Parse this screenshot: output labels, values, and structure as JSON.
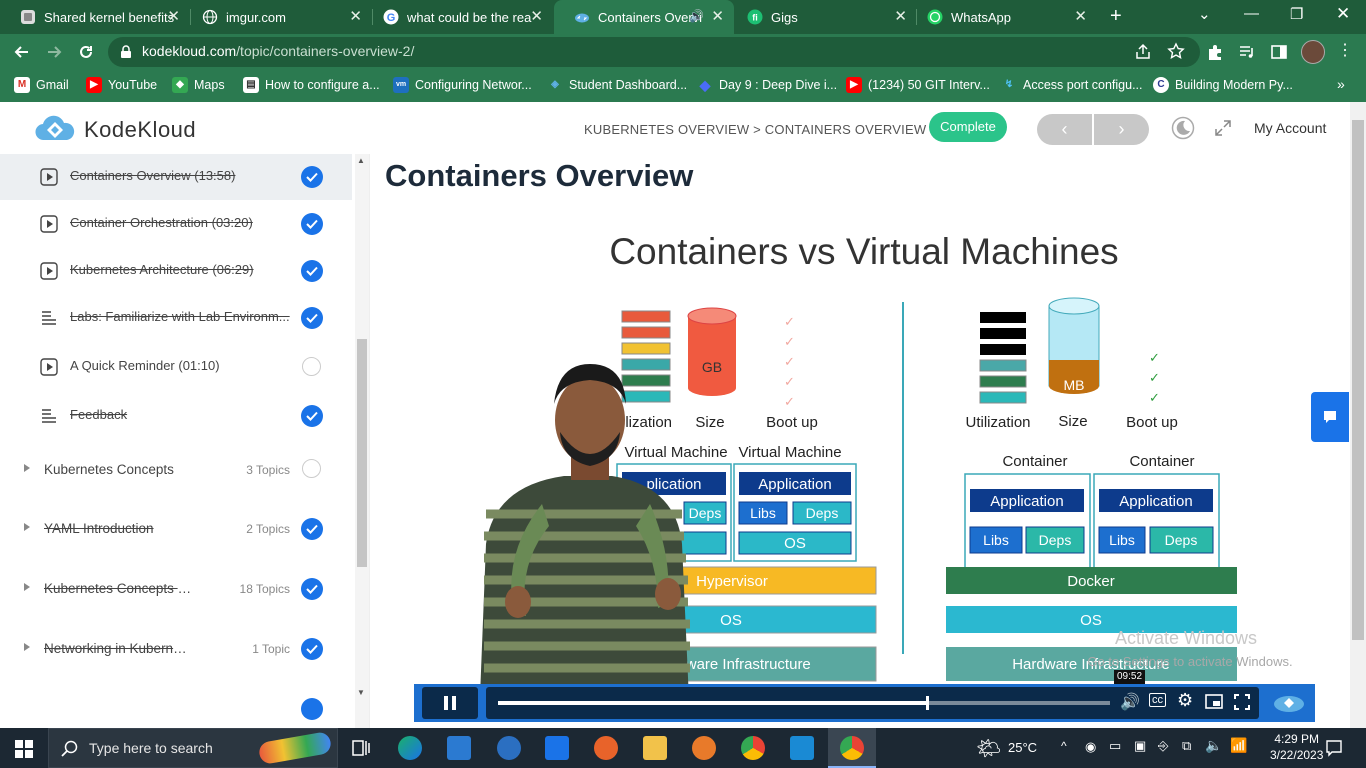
{
  "tabs": [
    {
      "title": "Shared kernel benefits"
    },
    {
      "title": "imgur.com"
    },
    {
      "title": "what could be the rea"
    },
    {
      "title": "Containers Overvi"
    },
    {
      "title": "Gigs"
    },
    {
      "title": "WhatsApp"
    }
  ],
  "url": {
    "host": "kodekloud.com",
    "path": "/topic/containers-overview-2/"
  },
  "bookmarks": [
    {
      "label": "Gmail"
    },
    {
      "label": "YouTube"
    },
    {
      "label": "Maps"
    },
    {
      "label": "How to configure a..."
    },
    {
      "label": "Configuring Networ..."
    },
    {
      "label": "Student Dashboard..."
    },
    {
      "label": "Day 9 : Deep Dive i..."
    },
    {
      "label": "(1234) 50 GIT Interv..."
    },
    {
      "label": "Access port configu..."
    },
    {
      "label": "Building Modern Py..."
    }
  ],
  "header": {
    "logo": "KodeKloud",
    "breadcrumb": "KUBERNETES OVERVIEW > CONTAINERS OVERVIEW",
    "complete": "Complete",
    "prev": "‹",
    "next": "›",
    "account": "My Account"
  },
  "lessons": [
    {
      "label": "Containers Overview (13:58)",
      "done": true
    },
    {
      "label": "Container Orchestration (03:20)",
      "done": true
    },
    {
      "label": "Kubernetes Architecture (06:29)",
      "done": true
    },
    {
      "label": "Labs: Familiarize with Lab Environm...",
      "done": true
    },
    {
      "label": "A Quick Reminder (01:10)",
      "done": false
    },
    {
      "label": "Feedback",
      "done": true
    }
  ],
  "sections": [
    {
      "label": "Kubernetes Concepts",
      "count": "3 Topics",
      "done": false
    },
    {
      "label": "YAML Introduction",
      "count": "2 Topics",
      "done": true
    },
    {
      "label": "Kubernetes Concepts - PO...",
      "count": "18 Topics",
      "done": true
    },
    {
      "label": "Networking in Kubernetes",
      "count": "1 Topic",
      "done": true
    }
  ],
  "page_title": "Containers Overview",
  "slide": {
    "title": "Containers vs Virtual Machines",
    "vm": {
      "gb": "GB",
      "utilization": "ilization",
      "size": "Size",
      "bootup": "Boot up",
      "vm1": "Virtual Machine",
      "vm2": "Virtual Machine",
      "app1": "plication",
      "app2": "Application",
      "libs": "Libs",
      "deps": "Deps",
      "os": "OS",
      "hypervisor": "Hypervisor",
      "hostos": "OS",
      "hw": "Hardware Infrastructure"
    },
    "ct": {
      "mb": "MB",
      "utilization": "Utilization",
      "size": "Size",
      "bootup": "Boot up",
      "c1": "Container",
      "c2": "Container",
      "app": "Application",
      "libs": "Libs",
      "deps": "Deps",
      "docker": "Docker",
      "os": "OS",
      "hw": "Hardware Infrastructure"
    },
    "watermark1": "Activate Windows",
    "watermark2": "Go to Settings to activate Windows."
  },
  "video": {
    "time": "09:52",
    "progress": 0.7
  },
  "taskbar": {
    "search_placeholder": "Type here to search",
    "weather": "25°C",
    "time": "4:29 PM",
    "date": "3/22/2023"
  }
}
